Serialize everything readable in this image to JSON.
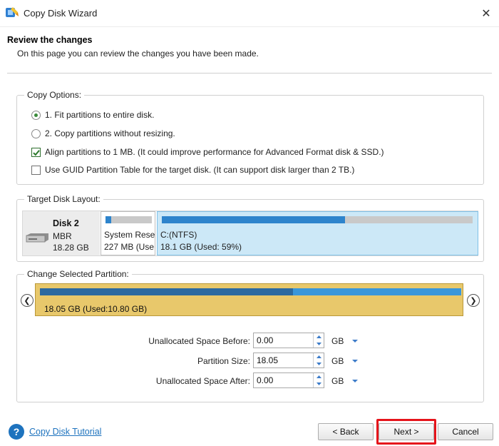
{
  "window": {
    "title": "Copy Disk Wizard"
  },
  "header": {
    "title": "Review the changes",
    "subtitle": "On this page you can review the changes you have been made."
  },
  "copy_options": {
    "label": "Copy Options:",
    "radio_fit": {
      "label": "1. Fit partitions to entire disk.",
      "selected": true
    },
    "radio_no_resize": {
      "label": "2. Copy partitions without resizing.",
      "selected": false
    },
    "check_align": {
      "label": "Align partitions to 1 MB.  (It could improve performance for Advanced Format disk & SSD.)",
      "checked": true
    },
    "check_gpt": {
      "label": "Use GUID Partition Table for the target disk. (It can support disk larger than 2 TB.)",
      "checked": false
    }
  },
  "target_disk": {
    "label": "Target Disk Layout:",
    "disk": {
      "name": "Disk 2",
      "type": "MBR",
      "size": "18.28 GB"
    },
    "partitions": [
      {
        "name": "System Rese",
        "info": "227 MB (Use",
        "used_percent": 12
      },
      {
        "name": "C:(NTFS)",
        "info": "18.1 GB (Used: 59%)",
        "used_percent": 59
      }
    ]
  },
  "change_partition": {
    "label": "Change Selected Partition:",
    "bar_text": "18.05 GB (Used:10.80 GB)",
    "used_percent": 60,
    "fields": {
      "before": {
        "label": "Unallocated Space Before:",
        "value": "0.00",
        "unit": "GB"
      },
      "size": {
        "label": "Partition Size:",
        "value": "18.05",
        "unit": "GB"
      },
      "after": {
        "label": "Unallocated Space After:",
        "value": "0.00",
        "unit": "GB"
      }
    }
  },
  "footer": {
    "tutorial": "Copy Disk Tutorial",
    "back": "< Back",
    "next": "Next >",
    "cancel": "Cancel"
  },
  "colors": {
    "partition_fill": "#2e84cc",
    "selected_block": "#e8c86b",
    "highlight": "#e5141b",
    "link": "#1e73be"
  }
}
